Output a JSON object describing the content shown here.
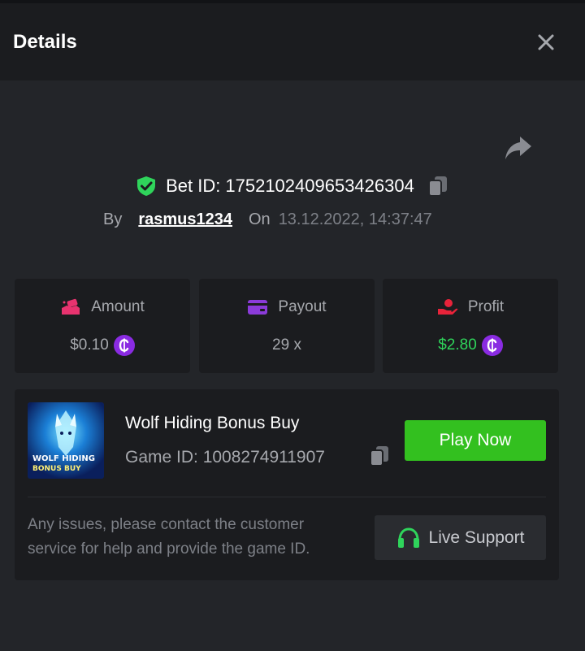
{
  "header": {
    "title": "Details"
  },
  "bet": {
    "id_label": "Bet ID:",
    "id_value": "1752102409653426304",
    "by_label": "By",
    "username": "rasmus1234",
    "on_label": "On",
    "datetime": "13.12.2022, 14:37:47"
  },
  "stats": [
    {
      "label": "Amount",
      "value": "$0.10",
      "icon": "money-icon",
      "coin": true
    },
    {
      "label": "Payout",
      "value": "29 x",
      "icon": "card-icon",
      "coin": false
    },
    {
      "label": "Profit",
      "value": "$2.80",
      "icon": "profit-hand-icon",
      "coin": true
    }
  ],
  "game": {
    "name": "Wolf Hiding Bonus Buy",
    "id_label": "Game ID:",
    "id_value": "1008274911907",
    "id_full": "Game ID: 1008274911907",
    "thumb_line1": "WOLF HIDING",
    "thumb_line2": "BONUS BUY",
    "play_label": "Play Now"
  },
  "support": {
    "help_text": "Any issues, please contact the customer service for help and provide the game ID.",
    "button_label": "Live Support"
  },
  "colors": {
    "accent_green": "#33c01f",
    "profit_green": "#2fd45b",
    "coin_purple": "#8a2be2",
    "amount_pink": "#e8336f",
    "profit_red": "#e8233a",
    "payout_purple": "#8b3bd9"
  }
}
